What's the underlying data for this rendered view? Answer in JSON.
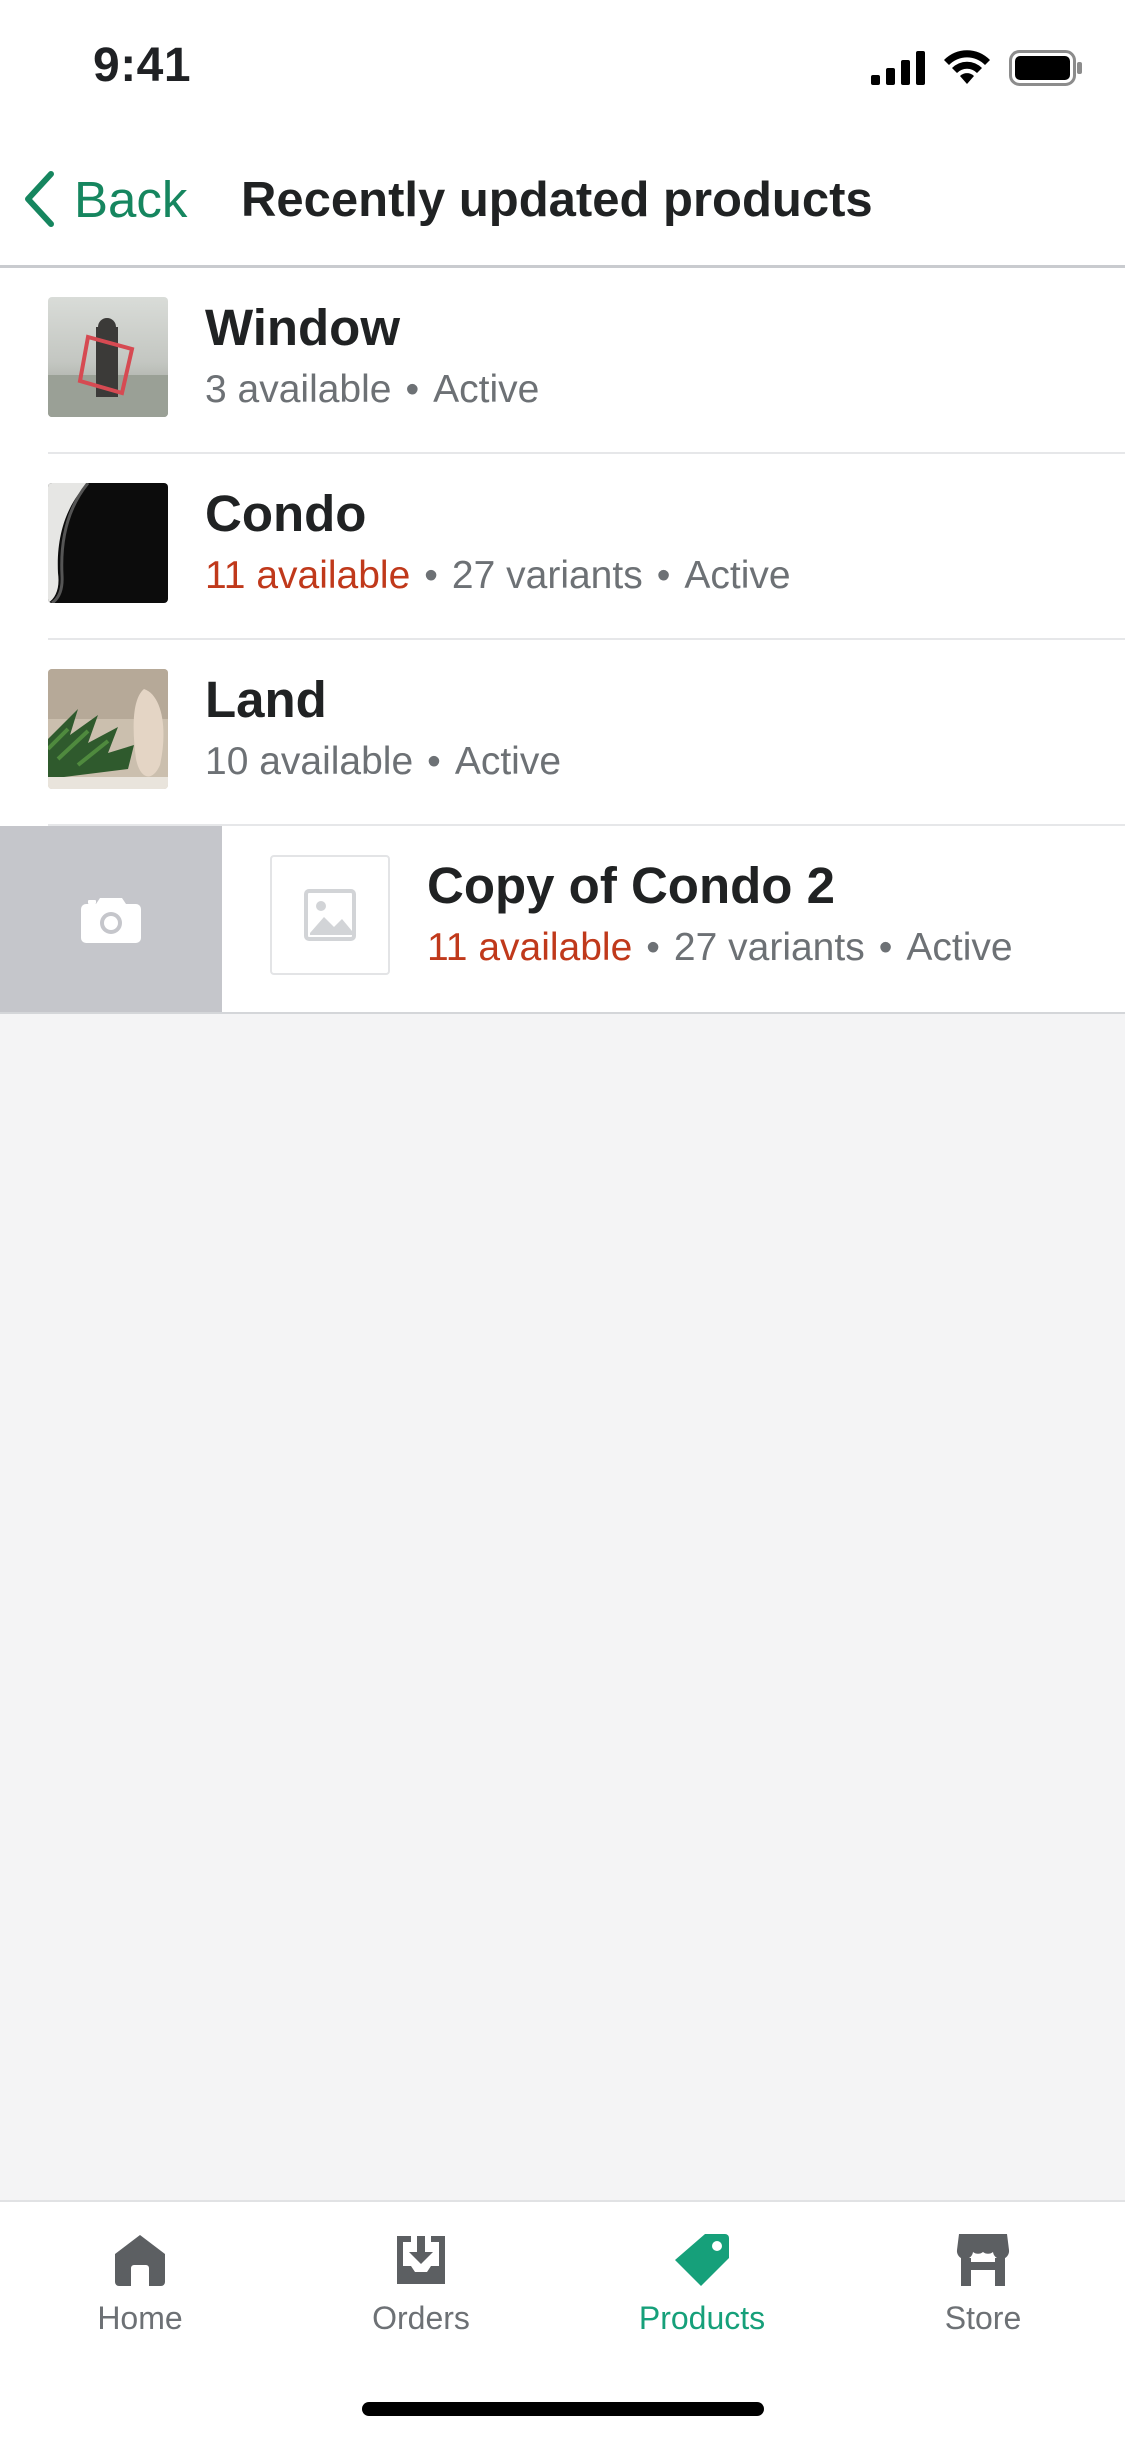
{
  "status_bar": {
    "time": "9:41"
  },
  "nav": {
    "back_label": "Back",
    "title": "Recently updated products"
  },
  "products": [
    {
      "title": "Window",
      "available": "3 available",
      "variants": "",
      "status": "Active",
      "low_stock": false
    },
    {
      "title": "Condo",
      "available": "11 available",
      "variants": "27 variants",
      "status": "Active",
      "low_stock": true
    },
    {
      "title": "Land",
      "available": "10 available",
      "variants": "",
      "status": "Active",
      "low_stock": false
    },
    {
      "title": "Copy of Condo 2",
      "available": "11 available",
      "variants": "27 variants",
      "status": "Active",
      "low_stock": true
    }
  ],
  "tabs": [
    {
      "label": "Home",
      "icon": "home-icon",
      "active": false
    },
    {
      "label": "Orders",
      "icon": "orders-icon",
      "active": false
    },
    {
      "label": "Products",
      "icon": "tag-icon",
      "active": true
    },
    {
      "label": "Store",
      "icon": "store-icon",
      "active": false
    }
  ],
  "colors": {
    "accent": "#16865f",
    "tab_active": "#16a07a",
    "warning": "#c0391b",
    "swipe_action_bg": "#c5c6cb"
  }
}
